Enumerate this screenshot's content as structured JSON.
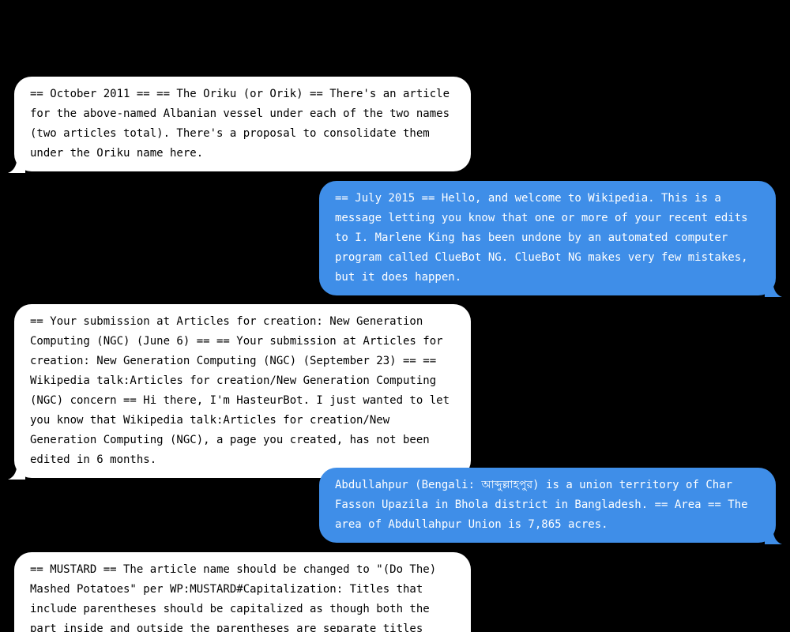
{
  "colors": {
    "background": "#000000",
    "incoming_bubble": "#ffffff",
    "incoming_text": "#000000",
    "outgoing_bubble": "#3f8ee8",
    "outgoing_text": "#ffffff"
  },
  "messages": [
    {
      "side": "incoming",
      "text": "== October 2011 == == The Oriku (or Orik) == There's an article for the above-named Albanian vessel under each of the two names (two articles total). There's a proposal to consolidate them under the Oriku name here."
    },
    {
      "side": "outgoing",
      "text": "== July 2015 == Hello, and welcome to Wikipedia. This is a message letting you know that one or more of your recent edits to I. Marlene King has been undone by an automated computer program called ClueBot NG. ClueBot NG makes very few mistakes, but it does happen."
    },
    {
      "side": "incoming",
      "text": "== Your submission at Articles for creation: New Generation Computing (NGC) (June 6) == == Your submission at Articles for creation: New Generation Computing (NGC) (September 23) == == Wikipedia talk:Articles for creation/New Generation Computing (NGC) concern == Hi there, I'm HasteurBot. I just wanted to let you know that Wikipedia talk:Articles for creation/New Generation Computing (NGC), a page you created, has not been edited in 6 months."
    },
    {
      "side": "outgoing",
      "text": "Abdullahpur (Bengali: আব্দুল্লাহপুর) is a union territory of Char Fasson Upazila in Bhola district in Bangladesh. == Area == The area of Abdullahpur Union is 7,865 acres."
    },
    {
      "side": "incoming",
      "text": "== MUSTARD == The article name should be changed to \"(Do The) Mashed Potatoes\" per WP:MUSTARD#Capitalization: Titles that include parentheses should be capitalized as though both the part inside and outside the parentheses are separate titles (e.g., \"(Don't"
    }
  ]
}
